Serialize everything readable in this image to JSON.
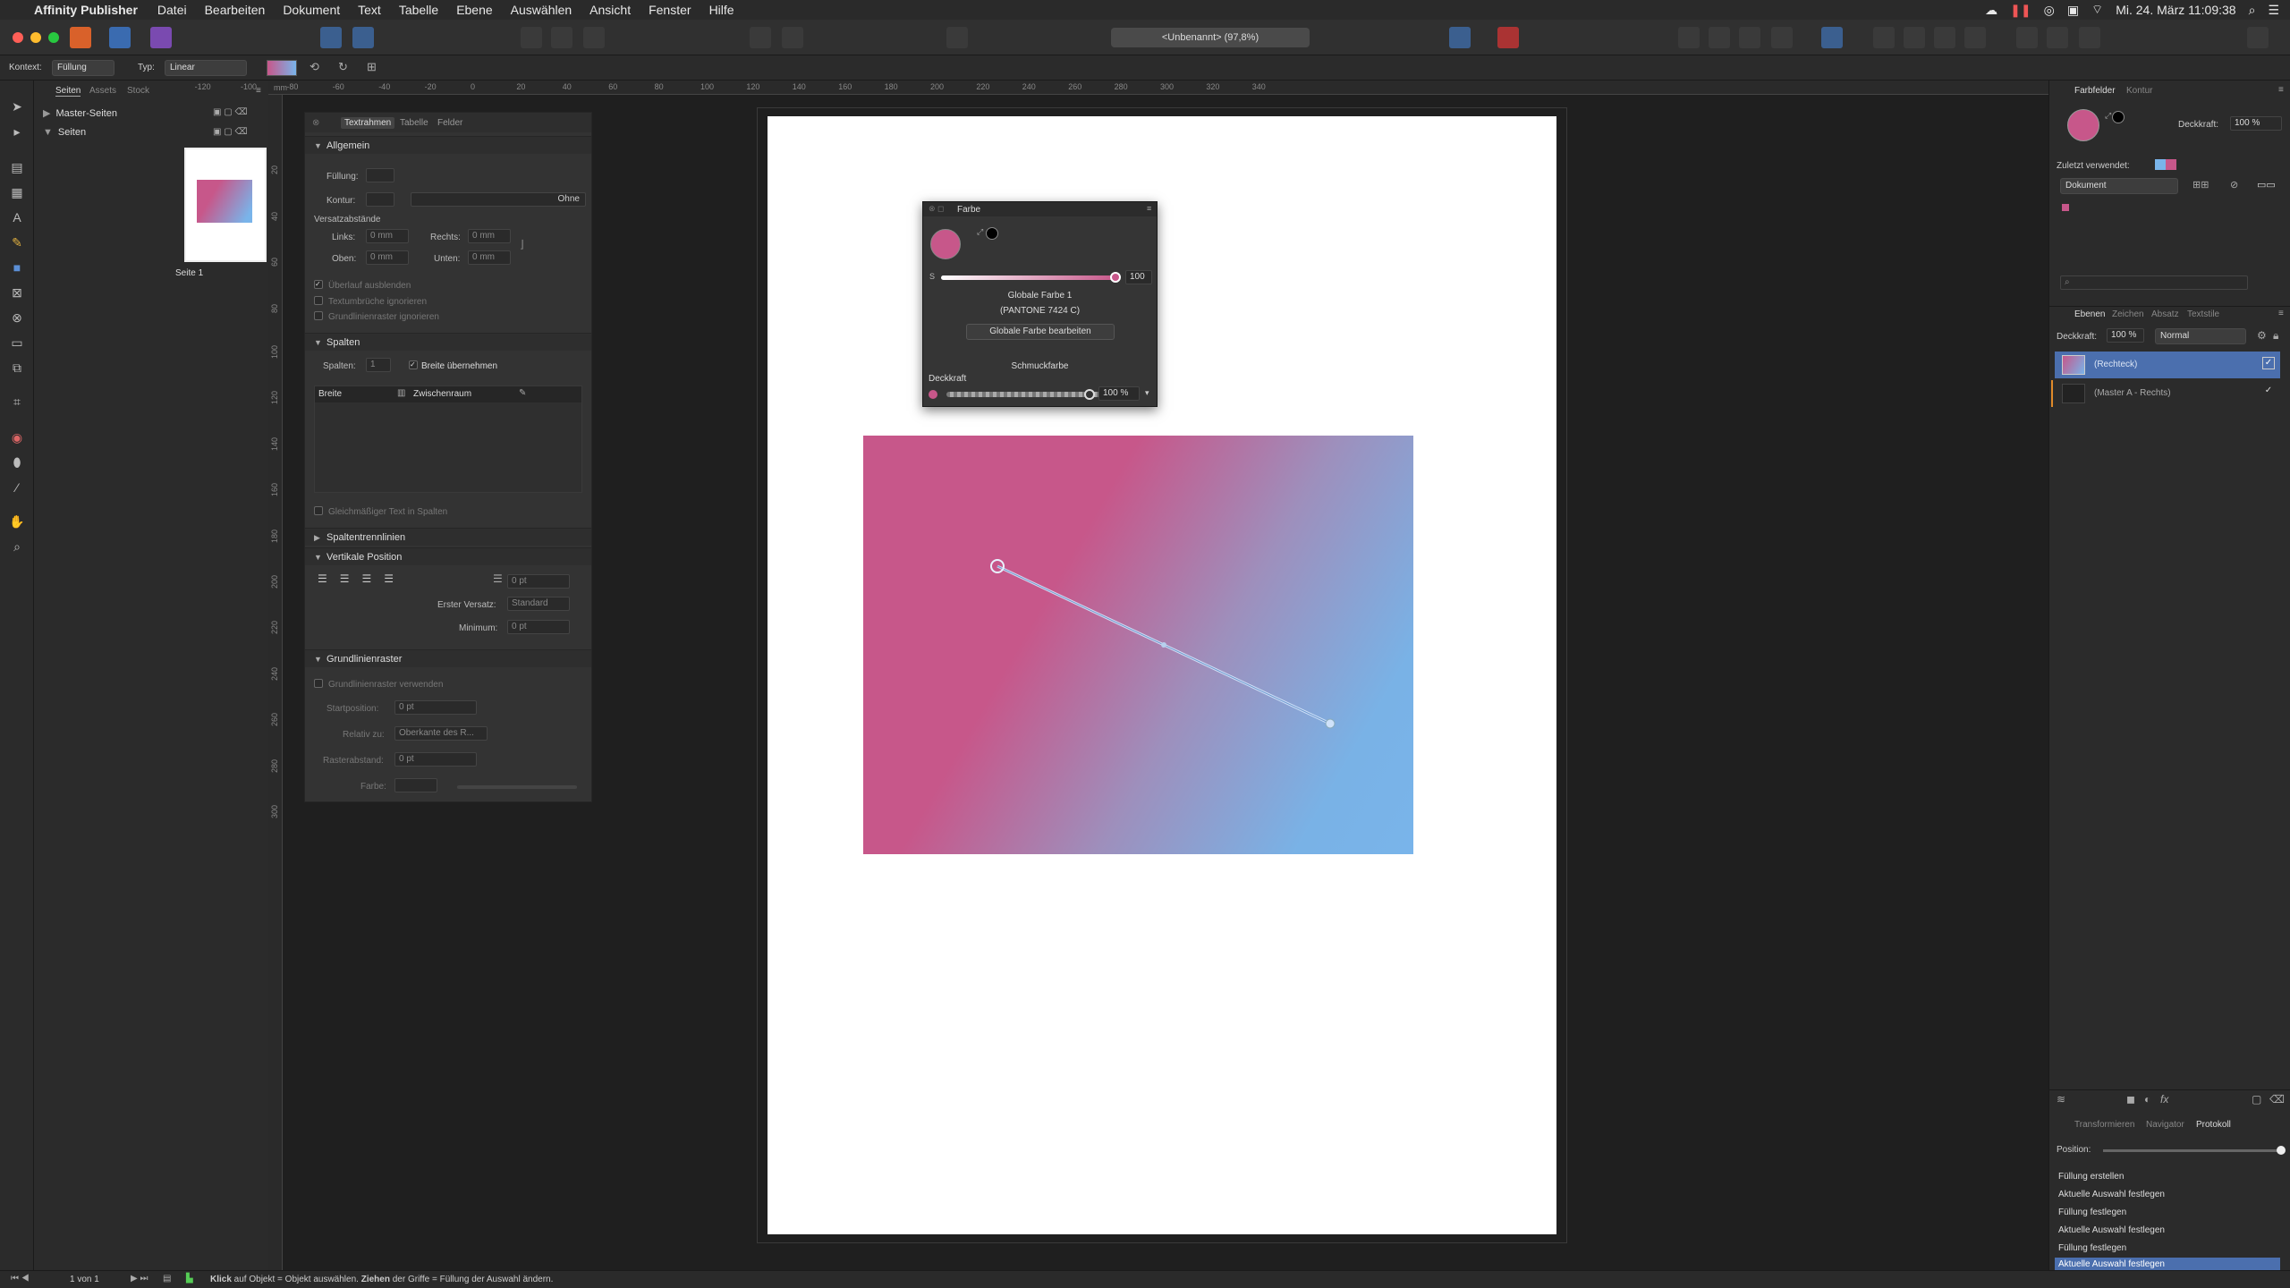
{
  "menubar": {
    "app": "Affinity Publisher",
    "items": [
      "Datei",
      "Bearbeiten",
      "Dokument",
      "Text",
      "Tabelle",
      "Ebene",
      "Auswählen",
      "Ansicht",
      "Fenster",
      "Hilfe"
    ],
    "clock": "Mi. 24. März  11:09:38"
  },
  "toolbar": {
    "doc_title": "<Unbenannt> (97,8%)"
  },
  "context": {
    "kontext_label": "Kontext:",
    "kontext_value": "Füllung",
    "typ_label": "Typ:",
    "typ_value": "Linear",
    "gradient_colors": [
      "#c7578a",
      "#79b4ea"
    ]
  },
  "pages_panel": {
    "tabs": [
      "Seiten",
      "Assets",
      "Stock"
    ],
    "master": "Master-Seiten",
    "pages": "Seiten",
    "page1": "Seite 1"
  },
  "ruler": {
    "h_unit": "mm",
    "h_labels": [
      "-120",
      "-100",
      "-80",
      "-60",
      "-40",
      "-20",
      "0",
      "20",
      "40",
      "60",
      "80",
      "100",
      "120",
      "140",
      "160",
      "180",
      "200",
      "220",
      "240",
      "260",
      "280",
      "300",
      "320",
      "340"
    ],
    "v_labels": [
      "20",
      "40",
      "60",
      "80",
      "100",
      "120",
      "140",
      "160",
      "180",
      "200",
      "220",
      "240",
      "260",
      "280",
      "300"
    ]
  },
  "textframe": {
    "tabs": [
      "Textrahmen",
      "Tabelle",
      "Felder"
    ],
    "allgemein": "Allgemein",
    "fuellung": "Füllung:",
    "kontur": "Kontur:",
    "ohne": "Ohne",
    "versatz": "Versatzabstände",
    "links": "Links:",
    "links_val": "0 mm",
    "rechts": "Rechts:",
    "rechts_val": "0 mm",
    "oben": "Oben:",
    "oben_val": "0 mm",
    "unten": "Unten:",
    "unten_val": "0 mm",
    "ueberlauf": "Überlauf ausblenden",
    "textumbrueche": "Textumbrüche ignorieren",
    "grundlinien_ign": "Grundlinienraster ignorieren",
    "spalten_head": "Spalten",
    "spalten": "Spalten:",
    "spalten_val": "1",
    "breite_uebernehmen": "Breite übernehmen",
    "breite": "Breite",
    "zwischenraum": "Zwischenraum",
    "gleichmaessig": "Gleichmäßiger Text in Spalten",
    "spaltentrenn": "Spaltentrennlinien",
    "vertikal": "Vertikale Position",
    "vert_val": "0 pt",
    "erster_versatz": "Erster Versatz:",
    "erster_val": "Standard",
    "minimum": "Minimum:",
    "minimum_val": "0 pt",
    "grundlinien_head": "Grundlinienraster",
    "grundlinien_use": "Grundlinienraster verwenden",
    "startposition": "Startposition:",
    "start_val": "0 pt",
    "relativ": "Relativ zu:",
    "relativ_val": "Oberkante des R...",
    "rasterabstand": "Rasterabstand:",
    "raster_val": "0 pt",
    "farbe": "Farbe:"
  },
  "farbe_popup": {
    "title": "Farbe",
    "s_label": "S",
    "s_value": "100",
    "global_name": "Globale Farbe 1",
    "pantone": "(PANTONE 7424 C)",
    "edit_button": "Globale Farbe bearbeiten",
    "schmuck": "Schmuckfarbe",
    "deckkraft": "Deckkraft",
    "deckkraft_val": "100 %",
    "color": "#c7578a"
  },
  "right_panel": {
    "tabs1": [
      "Farbfelder",
      "Kontur"
    ],
    "deckkraft_label": "Deckkraft:",
    "deckkraft_val": "100 %",
    "zuletzt": "Zuletzt verwendet:",
    "dokument": "Dokument",
    "tabs2": [
      "Ebenen",
      "Zeichen",
      "Absatz",
      "Textstile"
    ],
    "layer_deckkraft": "Deckkraft:",
    "layer_deckkraft_val": "100 %",
    "blend": "Normal",
    "layers": [
      "(Rechteck)",
      "(Master A - Rechts)"
    ],
    "tabs3": [
      "Transformieren",
      "Navigator",
      "Protokoll"
    ],
    "position": "Position:",
    "history": [
      "Füllung erstellen",
      "Aktuelle Auswahl festlegen",
      "Füllung festlegen",
      "Aktuelle Auswahl festlegen",
      "Füllung festlegen",
      "Aktuelle Auswahl festlegen"
    ]
  },
  "status": {
    "pages": "1 von 1",
    "klick": "Klick",
    "t1": " auf Objekt = Objekt auswählen. ",
    "ziehen": "Ziehen",
    "t2": " der Griffe = Füllung der Auswahl ändern."
  }
}
